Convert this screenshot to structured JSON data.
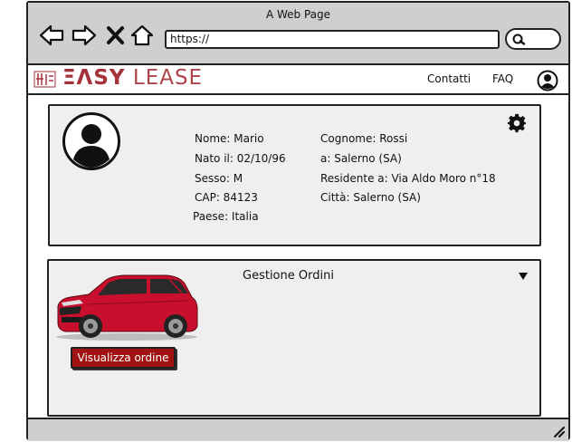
{
  "browser": {
    "title": "A Web Page",
    "url": "https://"
  },
  "header": {
    "logo_text_bold": "ΞΛSY",
    "logo_text_light": "LEASE",
    "nav": [
      "Contatti",
      "FAQ"
    ]
  },
  "profile": {
    "left": [
      {
        "label": "Nome: Mario"
      },
      {
        "label": "Nato il: 02/10/96"
      },
      {
        "label": "Sesso: M"
      },
      {
        "label": "CAP: 84123"
      },
      {
        "label": "Paese: Italia"
      }
    ],
    "right": [
      {
        "label": "Cognome: Rossi"
      },
      {
        "label": "a: Salerno (SA)"
      },
      {
        "label": "Residente a: Via Aldo Moro n°18"
      },
      {
        "label": "Città: Salerno (SA)"
      }
    ]
  },
  "orders": {
    "title": "Gestione Ordini",
    "button_label": "Visualizza ordine"
  },
  "colors": {
    "brand": "#a5323a",
    "button": "#a11212",
    "chrome": "#cfcfcf",
    "card": "#efefef"
  }
}
